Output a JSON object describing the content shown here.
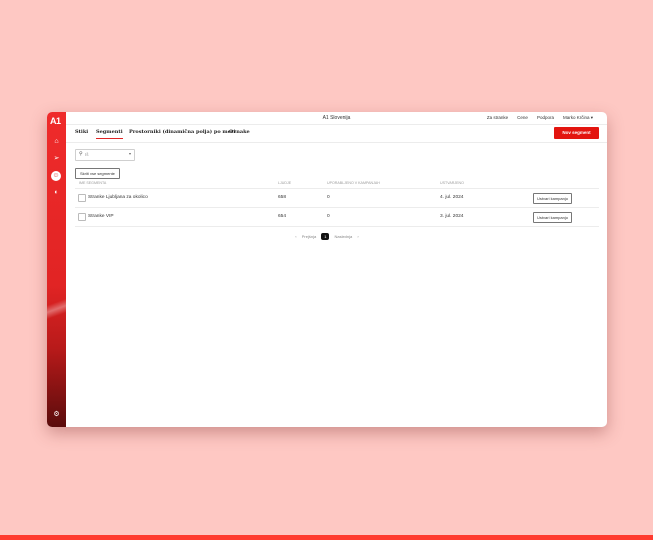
{
  "app": {
    "logo": "A1",
    "title": "A1 Slovenija"
  },
  "topnav": {
    "items": [
      "Za stranke",
      "Cene",
      "Podpora",
      "Marko Krčina"
    ],
    "user_caret": "▾"
  },
  "tabs": [
    "Stiki",
    "Segmenti",
    "Prostorniki (dinamična polja) po meri",
    "Oznake"
  ],
  "active_tab": "Segmenti",
  "new_button": "Nov segment",
  "search": {
    "placeholder": "Iš",
    "icon": "search-icon",
    "caret": "▾"
  },
  "filter_chip": "Skriti vse segmente",
  "table": {
    "headers": [
      "IME SEGMENTA",
      "LJUDJE",
      "UPORABLJENO V KAMPANJAH",
      "USTVARJENO"
    ],
    "rows": [
      {
        "name": "Stranke Ljubljana za okolico",
        "people": "658",
        "used": "0",
        "created": "4. jul. 2024",
        "action": "Ustvari kampanjo"
      },
      {
        "name": "Stranke VIP",
        "people": "654",
        "used": "0",
        "created": "3. jul. 2024",
        "action": "Ustvari kampanjo"
      }
    ]
  },
  "pagination": {
    "prev_arrow": "‹",
    "prev": "Prejšnja",
    "page": "1",
    "next": "Naslednja",
    "next_arrow": "›"
  },
  "sidebar": {
    "icons": [
      "home-icon",
      "send-icon",
      "contacts-icon",
      "automation-icon",
      "settings-icon"
    ]
  },
  "colors": {
    "brand_red": "#e3150f",
    "background": "#fec8c3"
  }
}
